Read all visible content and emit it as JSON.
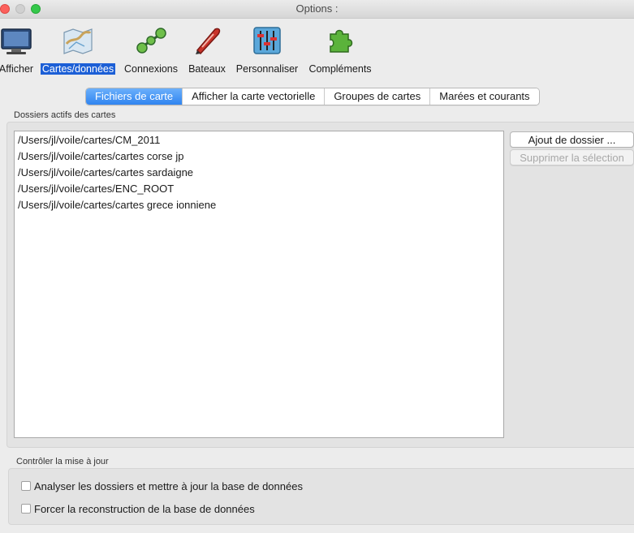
{
  "window": {
    "title": "Options :"
  },
  "toolbar": {
    "items": [
      {
        "label": "Afficher",
        "icon": "monitor-icon"
      },
      {
        "label": "Cartes/données",
        "icon": "map-chart-icon",
        "selected": true
      },
      {
        "label": "Connexions",
        "icon": "connections-icon"
      },
      {
        "label": "Bateaux",
        "icon": "boat-icon"
      },
      {
        "label": "Personnaliser",
        "icon": "sliders-icon"
      },
      {
        "label": "Compléments",
        "icon": "puzzle-icon"
      }
    ]
  },
  "tabs": [
    {
      "label": "Fichiers de carte",
      "active": true
    },
    {
      "label": "Afficher la carte vectorielle"
    },
    {
      "label": "Groupes de cartes"
    },
    {
      "label": "Marées et courants"
    }
  ],
  "folders_group": {
    "title": "Dossiers actifs des cartes",
    "items": [
      "/Users/jl/voile/cartes/CM_2011",
      "/Users/jl/voile/cartes/cartes corse jp",
      "/Users/jl/voile/cartes/cartes sardaigne",
      "/Users/jl/voile/cartes/ENC_ROOT",
      "/Users/jl/voile/cartes/cartes grece ionniene"
    ],
    "add_button": "Ajout de dossier ...",
    "remove_button": "Supprimer la sélection"
  },
  "update_group": {
    "title": "Contrôler la mise à jour",
    "scan_label": "Analyser les dossiers et mettre à jour la base de données",
    "rebuild_label": "Forcer la reconstruction de la base de données"
  },
  "colors": {
    "selection": "#1c5fd6",
    "tab_active": "#2f84f0"
  }
}
